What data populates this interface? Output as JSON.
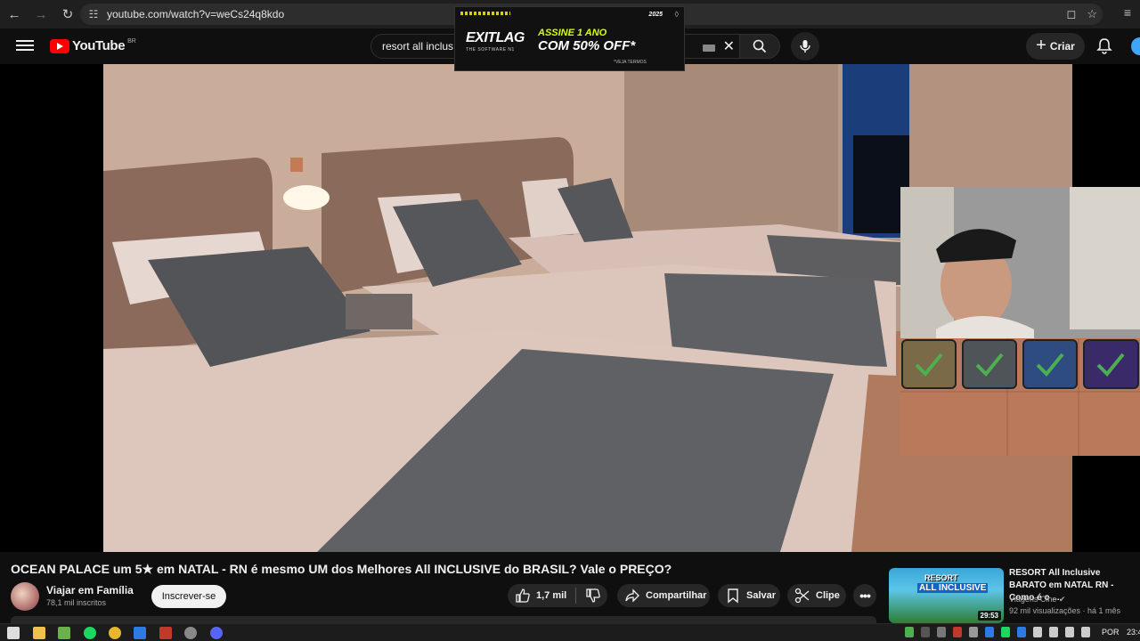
{
  "browser": {
    "url": "youtube.com/watch?v=weCs24q8kdo",
    "icons": [
      "back-icon",
      "forward-icon",
      "reload-icon",
      "site-settings-icon",
      "cast-icon",
      "star-icon",
      "menu-icon"
    ]
  },
  "header": {
    "logo_text": "YouTube",
    "country_code": "BR",
    "search_value": "resort all inclus",
    "create_label": "Criar",
    "icons": [
      "hamburger-icon",
      "search-icon",
      "mic-icon",
      "plus-icon",
      "bell-icon",
      "avatar-icon"
    ]
  },
  "ad": {
    "year": "2025",
    "brand": "EXITLAG",
    "tagline": "THE SOFTWARE N1",
    "line1": "ASSINE 1 ANO",
    "line2": "COM 50% OFF*",
    "terms": "*VEJA TERMOS"
  },
  "video": {
    "title": "OCEAN PALACE um 5★ em NATAL - RN é mesmo UM dos Melhores All INCLUSIVE do BRASIL? Vale o PREÇO?",
    "channel": "Viajar em Família",
    "subscribers": "78,1 mil inscritos",
    "subscribe_label": "Inscrever-se",
    "likes": "1,7 mil",
    "share_label": "Compartilhar",
    "save_label": "Salvar",
    "clip_label": "Clipe"
  },
  "recommended": {
    "title": "RESORT All Inclusive BARATO em NATAL RN - Como é o ...",
    "channel": "Viagens Cine",
    "meta": "92 mil visualizações · há 1 mês",
    "duration": "29:53",
    "thumb_text1": "RESORT",
    "thumb_text2": "ALL INCLUSIVE"
  },
  "taskbar": {
    "lang": "POR",
    "clock": "23:4"
  },
  "colors": {
    "bg": "#0f0f0f",
    "brand_red": "#ff0000",
    "accent_green": "#4caf50"
  }
}
